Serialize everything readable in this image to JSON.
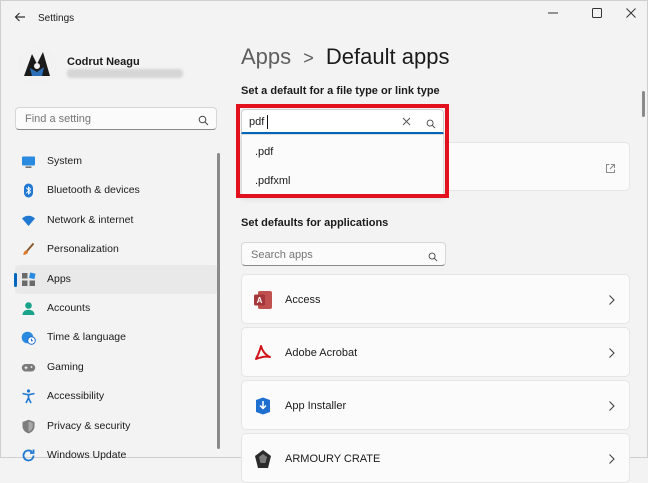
{
  "window": {
    "title": "Settings",
    "back_icon": "back-arrow-icon",
    "controls": {
      "minimize": "—",
      "maximize": "☐",
      "close": "✕"
    }
  },
  "profile": {
    "name": "Codrut Neagu"
  },
  "sidebar": {
    "search_placeholder": "Find a setting",
    "items": [
      {
        "label": "System",
        "icon": "system-icon",
        "active": false
      },
      {
        "label": "Bluetooth & devices",
        "icon": "bluetooth-icon",
        "active": false
      },
      {
        "label": "Network & internet",
        "icon": "wifi-icon",
        "active": false
      },
      {
        "label": "Personalization",
        "icon": "brush-icon",
        "active": false
      },
      {
        "label": "Apps",
        "icon": "apps-icon",
        "active": true
      },
      {
        "label": "Accounts",
        "icon": "accounts-icon",
        "active": false
      },
      {
        "label": "Time & language",
        "icon": "globe-clock-icon",
        "active": false
      },
      {
        "label": "Gaming",
        "icon": "gamepad-icon",
        "active": false
      },
      {
        "label": "Accessibility",
        "icon": "accessibility-icon",
        "active": false
      },
      {
        "label": "Privacy & security",
        "icon": "shield-icon",
        "active": false
      },
      {
        "label": "Windows Update",
        "icon": "update-icon",
        "active": false
      }
    ]
  },
  "breadcrumb": {
    "parent": "Apps",
    "separator": ">",
    "current": "Default apps"
  },
  "filetype": {
    "heading": "Set a default for a file type or link type",
    "search_value": "pdf",
    "suggestions": [
      ".pdf",
      ".pdfxml"
    ]
  },
  "applications": {
    "heading": "Set defaults for applications",
    "search_placeholder": "Search apps",
    "apps": [
      {
        "name": "Access",
        "icon": "access-icon",
        "color": "#a4373a"
      },
      {
        "name": "Adobe Acrobat",
        "icon": "acrobat-icon",
        "color": "#d1141b"
      },
      {
        "name": "App Installer",
        "icon": "app-installer-icon",
        "color": "#1f6fd0"
      },
      {
        "name": "ARMOURY CRATE",
        "icon": "armoury-crate-icon",
        "color": "#2b2b2b"
      }
    ]
  },
  "colors": {
    "accent": "#0067c0",
    "highlight": "#e3101e"
  }
}
